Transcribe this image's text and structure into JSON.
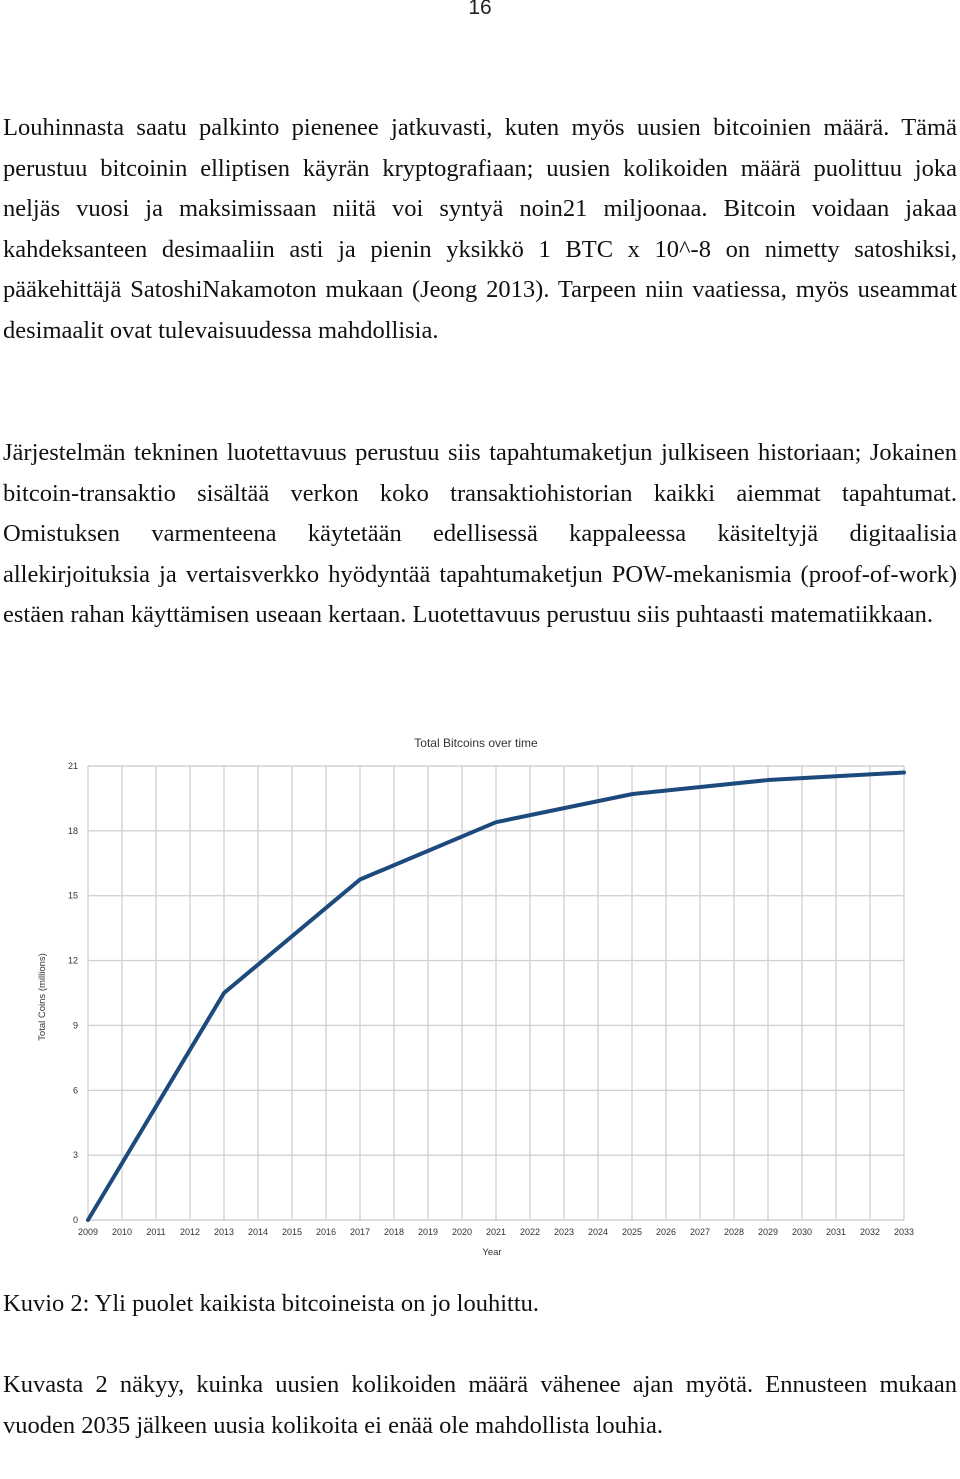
{
  "page": {
    "number": "16"
  },
  "paragraphs": {
    "p1": "Louhinnasta saatu palkinto pienenee jatkuvasti, kuten myös uusien bitcoinien määrä. Tämä perustuu bitcoinin elliptisen käyrän kryptografiaan; uusien kolikoiden määrä puolittuu joka neljäs vuosi ja maksimissaan niitä voi syntyä noin21 miljoonaa. Bitcoin voidaan jakaa kahdeksanteen desimaaliin asti ja pienin yksikkö 1 BTC x 10^-8 on nimetty satoshiksi, pääkehittäjä SatoshiNakamoton mukaan (Jeong 2013). Tarpeen niin vaatiessa, myös useammat desimaalit ovat tulevaisuudessa mahdollisia.",
    "p2": "Järjestelmän tekninen luotettavuus perustuu siis tapahtumaketjun julkiseen historiaan; Jokainen bitcoin-transaktio sisältää verkon koko transaktiohistorian kaikki aiemmat tapahtumat. Omistuksen varmenteena käytetään edellisessä kappaleessa käsiteltyjä digitaalisia allekirjoituksia ja vertaisverkko hyödyntää tapahtumaketjun POW-mekanismia (proof-of-work) estäen rahan käyttämisen useaan kertaan. Luotettavuus perustuu siis puhtaasti matematiikkaan.",
    "caption": "Kuvio 2: Yli puolet kaikista bitcoineista on jo louhittu.",
    "p3": "Kuvasta 2 näkyy, kuinka uusien kolikoiden määrä vähenee ajan myötä. Ennusteen mukaan vuoden 2035 jälkeen uusia kolikoita ei enää ole mahdollista louhia."
  },
  "chart_data": {
    "type": "line",
    "title": "Total Bitcoins over time",
    "xlabel": "Year",
    "ylabel": "Total Coins (millions)",
    "x_ticks": [
      "2009",
      "2010",
      "2011",
      "2012",
      "2013",
      "2014",
      "2015",
      "2016",
      "2017",
      "2018",
      "2019",
      "2020",
      "2021",
      "2022",
      "2023",
      "2024",
      "2025",
      "2026",
      "2027",
      "2028",
      "2029",
      "2030",
      "2031",
      "2032",
      "2033"
    ],
    "y_ticks": [
      "0",
      "3",
      "6",
      "9",
      "12",
      "15",
      "18",
      "21"
    ],
    "xlim": [
      2009,
      2033
    ],
    "ylim": [
      0,
      21
    ],
    "grid": true,
    "legend": "none",
    "color": "#1c4a7c",
    "series": [
      {
        "name": "Total Coins",
        "x": [
          2009,
          2013,
          2017,
          2021,
          2025,
          2029,
          2033
        ],
        "values": [
          0,
          10.5,
          15.75,
          18.4,
          19.7,
          20.35,
          20.7
        ]
      }
    ]
  }
}
